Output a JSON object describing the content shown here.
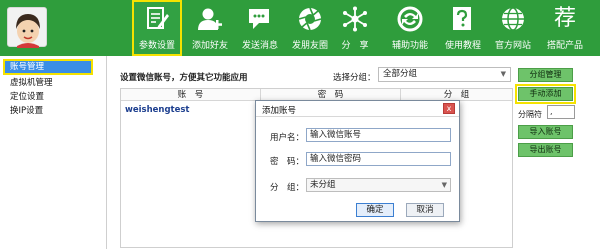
{
  "colors": {
    "toolbar_bg": "#2f9d3c",
    "highlight": "#f5e200",
    "side_btn": "#6ec36a",
    "selected_tree": "#3a8ee6"
  },
  "toolbar": {
    "items": [
      {
        "label": "参数设置",
        "icon": "document-pencil-icon",
        "active": true
      },
      {
        "label": "添加好友",
        "icon": "add-user-icon"
      },
      {
        "label": "发送消息",
        "icon": "chat-bubble-icon"
      },
      {
        "label": "发朋友圈",
        "icon": "camera-shutter-icon"
      },
      {
        "label": "分　享",
        "icon": "share-network-icon"
      },
      {
        "label": "辅助功能",
        "icon": "recycle-icon"
      },
      {
        "label": "使用教程",
        "icon": "help-question-icon"
      },
      {
        "label": "官方网站",
        "icon": "globe-icon"
      },
      {
        "label": "搭配产品",
        "icon": "logo-character-icon",
        "glyph": "荐"
      }
    ]
  },
  "left_tree": {
    "items": [
      {
        "label": "账号管理",
        "selected": true
      },
      {
        "label": "虚拟机管理"
      },
      {
        "label": "定位设置"
      },
      {
        "label": "换IP设置"
      }
    ]
  },
  "main": {
    "hint": "设置微信账号，方便其它功能应用",
    "group_label": "选择分组：",
    "group_value": "全部分组",
    "table": {
      "columns": [
        "账　号",
        "密　码",
        "分　组"
      ],
      "rows": [
        {
          "account": "weishengtest"
        }
      ]
    }
  },
  "right_panel": {
    "group_manage": "分组管理",
    "manual_add": "手动添加",
    "separator_label": "分隔符",
    "separator_value": ",",
    "import": "导入账号",
    "export": "导出账号"
  },
  "dialog": {
    "title": "添加账号",
    "close": "x",
    "username_label": "用户名：",
    "username_value": "输入微信账号",
    "password_label": "密　码：",
    "password_value": "输入微信密码",
    "group_label": "分　组：",
    "group_value": "未分组",
    "ok": "确定",
    "cancel": "取消"
  }
}
